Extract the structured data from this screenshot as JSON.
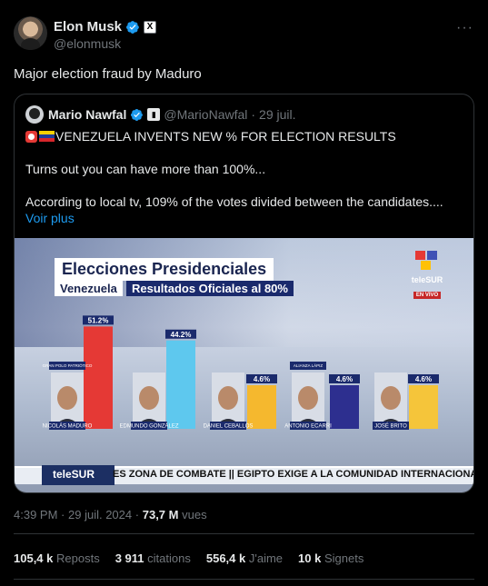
{
  "author": {
    "name": "Elon Musk",
    "handle": "@elonmusk",
    "affiliation_badge": "X"
  },
  "tweet_text": "Major election fraud by Maduro",
  "more_icon": "···",
  "quote": {
    "name": "Mario Nawfal",
    "handle": "@MarioNawfal",
    "separator": "·",
    "date": "29 juil.",
    "headline": "VENEZUELA INVENTS NEW % FOR ELECTION RESULTS",
    "line2": "Turns out you can have more than 100%...",
    "line3": "According to local tv, 109% of the votes divided between the candidates....",
    "read_more": "Voir plus",
    "image": {
      "title": "Elecciones Presidenciales",
      "subtitle_left": "Venezuela",
      "subtitle_right": "Resultados Oficiales al 80%",
      "channel": "teleSUR",
      "live_tag": "EN VIVO",
      "ticker_brand": "teleSUR",
      "ticker_text": "ES ZONA DE COMBATE  ||  EGIPTO EXIGE A LA COMUNIDAD INTERNACIONAL EVITAR",
      "candidates": [
        {
          "name": "NICOLÁS MADURO",
          "party": "GRAN POLO PATRIÓTICO",
          "value": 51.2,
          "label": "51.2%",
          "color": "#e53935"
        },
        {
          "name": "EDMUNDO GONZÁLEZ",
          "party": "",
          "value": 44.2,
          "label": "44.2%",
          "color": "#5ec8ee"
        },
        {
          "name": "DANIEL CEBALLOS",
          "party": "",
          "value": 4.6,
          "label": "4.6%",
          "color": "#f5b82e"
        },
        {
          "name": "ANTONIO ECARRI",
          "party": "ALIANZA LÁPIZ",
          "value": 4.6,
          "label": "4.6%",
          "color": "#2d2f8f"
        },
        {
          "name": "JOSÉ BRITO",
          "party": "",
          "value": 4.6,
          "label": "4.6%",
          "color": "#f5c53a"
        }
      ]
    }
  },
  "meta": {
    "time": "4:39 PM",
    "sep": "·",
    "date": "29 juil. 2024",
    "views": "73,7 M",
    "views_label": "vues"
  },
  "stats": [
    {
      "value": "105,4 k",
      "label": "Reposts"
    },
    {
      "value": "3 911",
      "label": "citations"
    },
    {
      "value": "556,4 k",
      "label": "J'aime"
    },
    {
      "value": "10 k",
      "label": "Signets"
    }
  ],
  "colors": {
    "background": "#000000",
    "text": "#e7e9ea",
    "muted": "#71767b",
    "link": "#1d9bf0",
    "verified": "#1d9bf0",
    "border": "#2f3336"
  }
}
